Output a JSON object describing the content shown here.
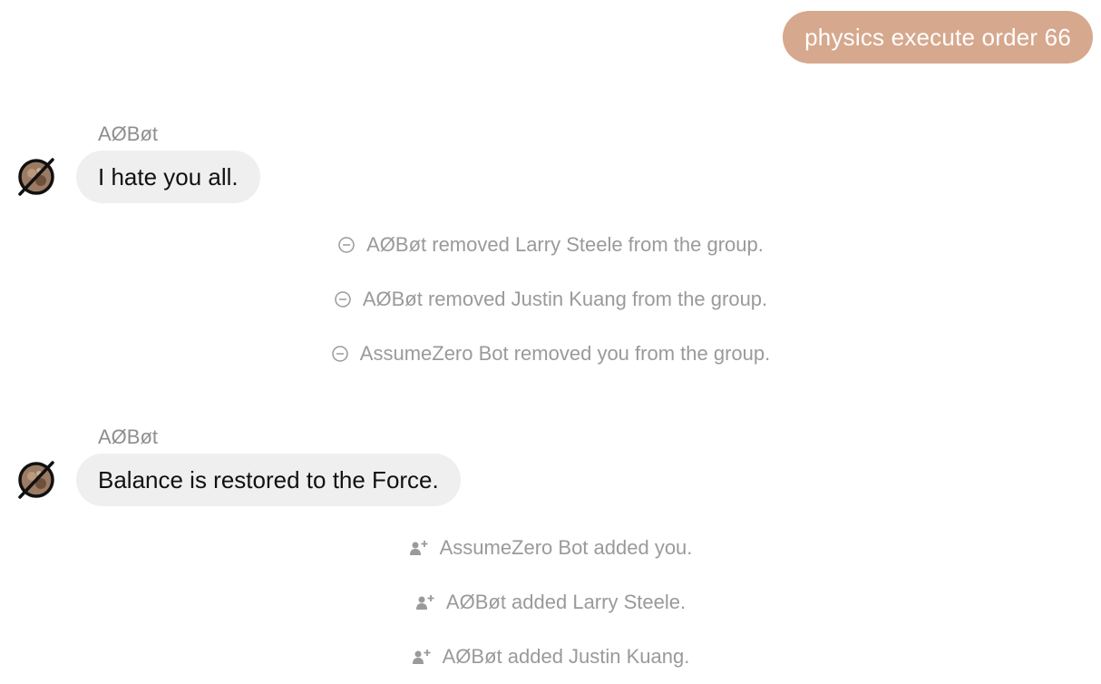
{
  "theme": {
    "accent": "#d6a88d",
    "incoming_bubble": "#efefef",
    "muted_text": "#9a9a9a"
  },
  "outgoing": {
    "text": "physics execute order 66"
  },
  "messages": [
    {
      "sender": "AØBøt",
      "text": "I hate you all.",
      "avatar_icon": "bot-avatar-icon"
    },
    {
      "sender": "AØBøt",
      "text": "Balance is restored to the Force.",
      "avatar_icon": "bot-avatar-icon"
    }
  ],
  "events": [
    {
      "icon": "remove-member-icon",
      "text": "AØBøt removed Larry Steele from the group."
    },
    {
      "icon": "remove-member-icon",
      "text": "AØBøt removed Justin Kuang from the group."
    },
    {
      "icon": "remove-member-icon",
      "text": "AssumeZero Bot removed you from the group."
    },
    {
      "icon": "add-member-icon",
      "text": "AssumeZero Bot added you."
    },
    {
      "icon": "add-member-icon",
      "text": "AØBøt added Larry Steele."
    },
    {
      "icon": "add-member-icon",
      "text": "AØBøt added Justin Kuang."
    }
  ]
}
